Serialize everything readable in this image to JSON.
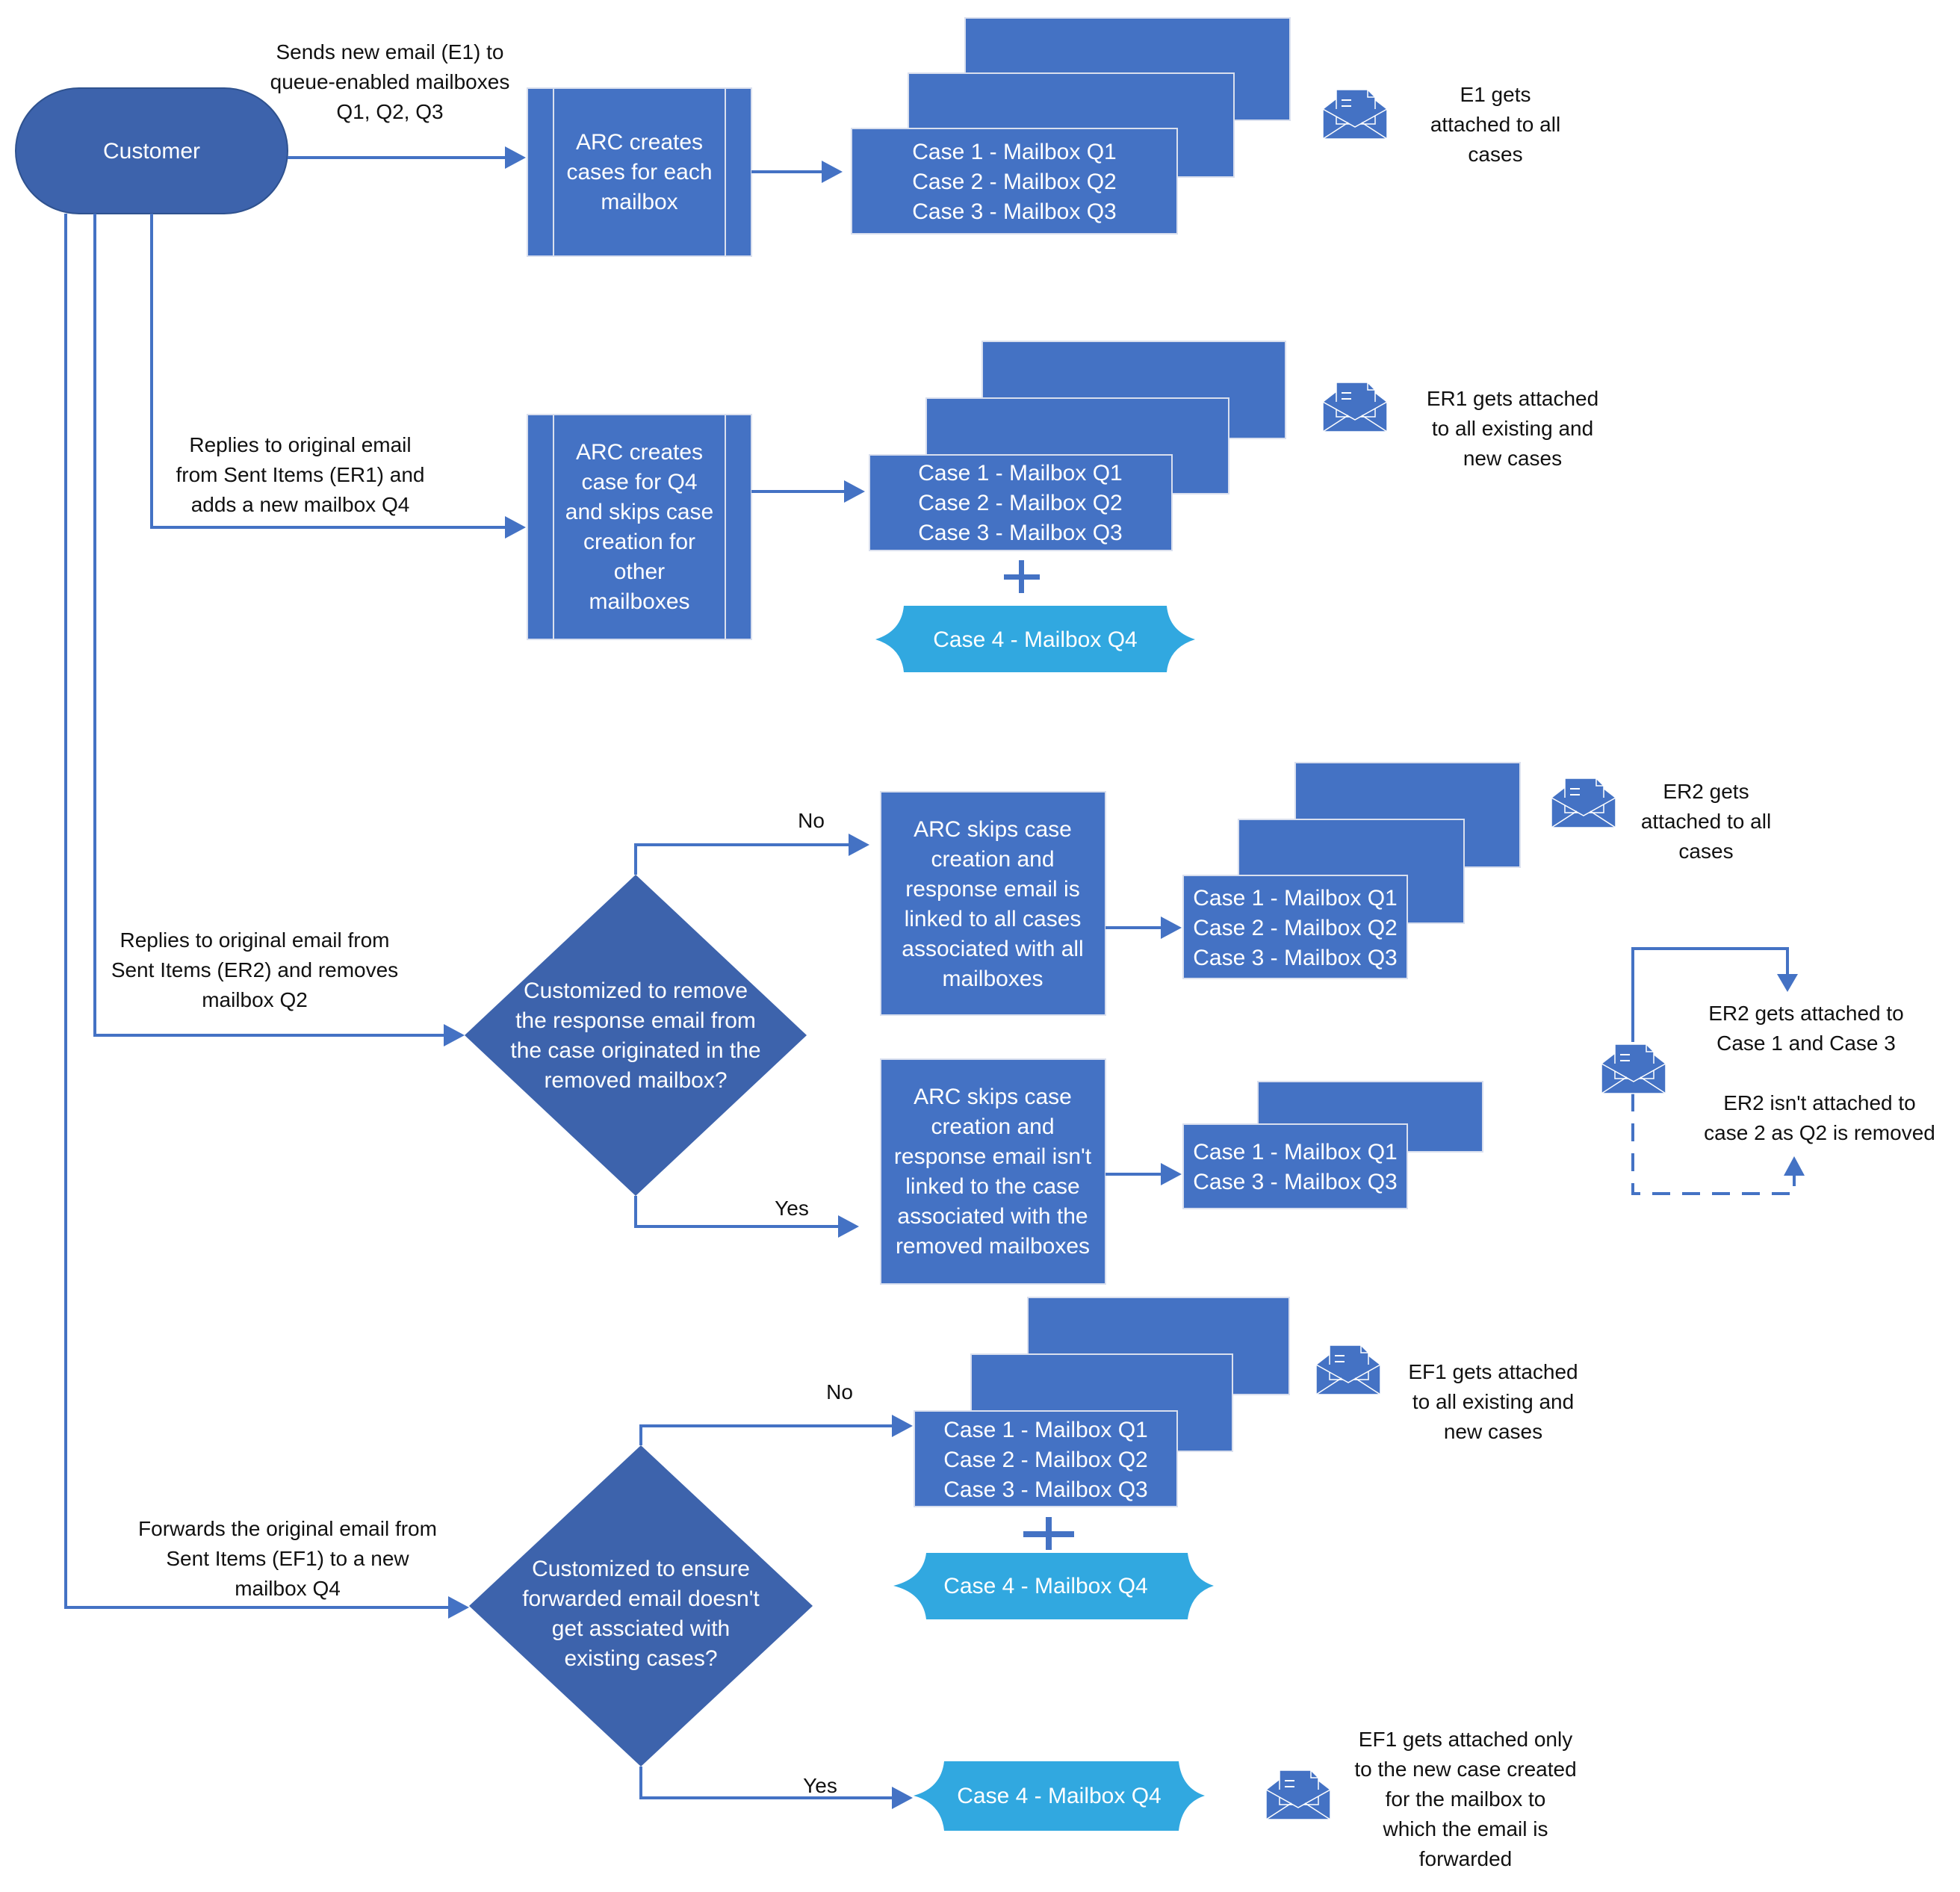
{
  "diagram": {
    "start": {
      "label": "Customer"
    },
    "colors": {
      "primary": "#4472c4",
      "decision": "#3d63ac",
      "new_case": "#31a8e0",
      "line": "#4472c4"
    },
    "flows": [
      {
        "edge_label": [
          "Sends new email (E1) to",
          "queue-enabled mailboxes",
          "Q1, Q2, Q3"
        ],
        "process": [
          "ARC creates",
          "cases for each",
          "mailbox"
        ],
        "cases": [
          "Case 1 - Mailbox Q1",
          "Case 2 - Mailbox Q2",
          "Case 3 - Mailbox Q3"
        ],
        "note": [
          "E1 gets",
          "attached to all",
          "cases"
        ]
      },
      {
        "edge_label": [
          "Replies to original email",
          "from Sent Items (ER1) and",
          "adds a new mailbox Q4"
        ],
        "process": [
          "ARC creates",
          "case for Q4",
          "and skips case",
          "creation for",
          "other",
          "mailboxes"
        ],
        "cases": [
          "Case 1 - Mailbox Q1",
          "Case 2 - Mailbox Q2",
          "Case 3 - Mailbox Q3"
        ],
        "plus": "+",
        "new_case": "Case 4 - Mailbox Q4",
        "note": [
          "ER1 gets attached",
          "to all existing and",
          "new cases"
        ]
      },
      {
        "edge_label": [
          "Replies to original email from",
          "Sent Items (ER2) and removes",
          "mailbox Q2"
        ],
        "decision": [
          "Customized to remove",
          "the response email from",
          "the case originated in the",
          "removed mailbox?"
        ],
        "no_label": "No",
        "yes_label": "Yes",
        "no_process": [
          "ARC skips case",
          "creation and",
          "response email is",
          "linked to all cases",
          "associated with all",
          "mailboxes"
        ],
        "no_cases": [
          "Case 1 - Mailbox Q1",
          "Case 2 - Mailbox Q2",
          "Case 3 - Mailbox Q3"
        ],
        "no_note": [
          "ER2 gets",
          "attached to all",
          "cases"
        ],
        "yes_process": [
          "ARC skips case",
          "creation and",
          "response email isn't",
          "linked to the case",
          "associated with the",
          "removed mailboxes"
        ],
        "yes_cases": [
          "Case 1 - Mailbox Q1",
          "Case 3 - Mailbox Q3"
        ],
        "side_note_top": [
          "ER2 gets attached to",
          "Case 1 and Case 3"
        ],
        "side_note_bottom": [
          "ER2 isn't attached to",
          "case 2 as Q2 is removed"
        ]
      },
      {
        "edge_label": [
          "Forwards the original email from",
          "Sent Items (EF1) to a new",
          "mailbox Q4"
        ],
        "decision": [
          "Customized to ensure",
          "forwarded email doesn't",
          "get assciated with",
          "existing cases?"
        ],
        "no_label": "No",
        "yes_label": "Yes",
        "no_cases": [
          "Case 1 - Mailbox Q1",
          "Case 2 - Mailbox Q2",
          "Case 3 - Mailbox Q3"
        ],
        "plus": "+",
        "no_new_case": "Case 4 - Mailbox Q4",
        "no_note": [
          "EF1 gets attached",
          "to all existing and",
          "new cases"
        ],
        "yes_new_case": "Case 4 - Mailbox Q4",
        "yes_note": [
          "EF1 gets attached only",
          "to the new case created",
          "for the mailbox to",
          "which the email is",
          "forwarded"
        ]
      }
    ]
  }
}
